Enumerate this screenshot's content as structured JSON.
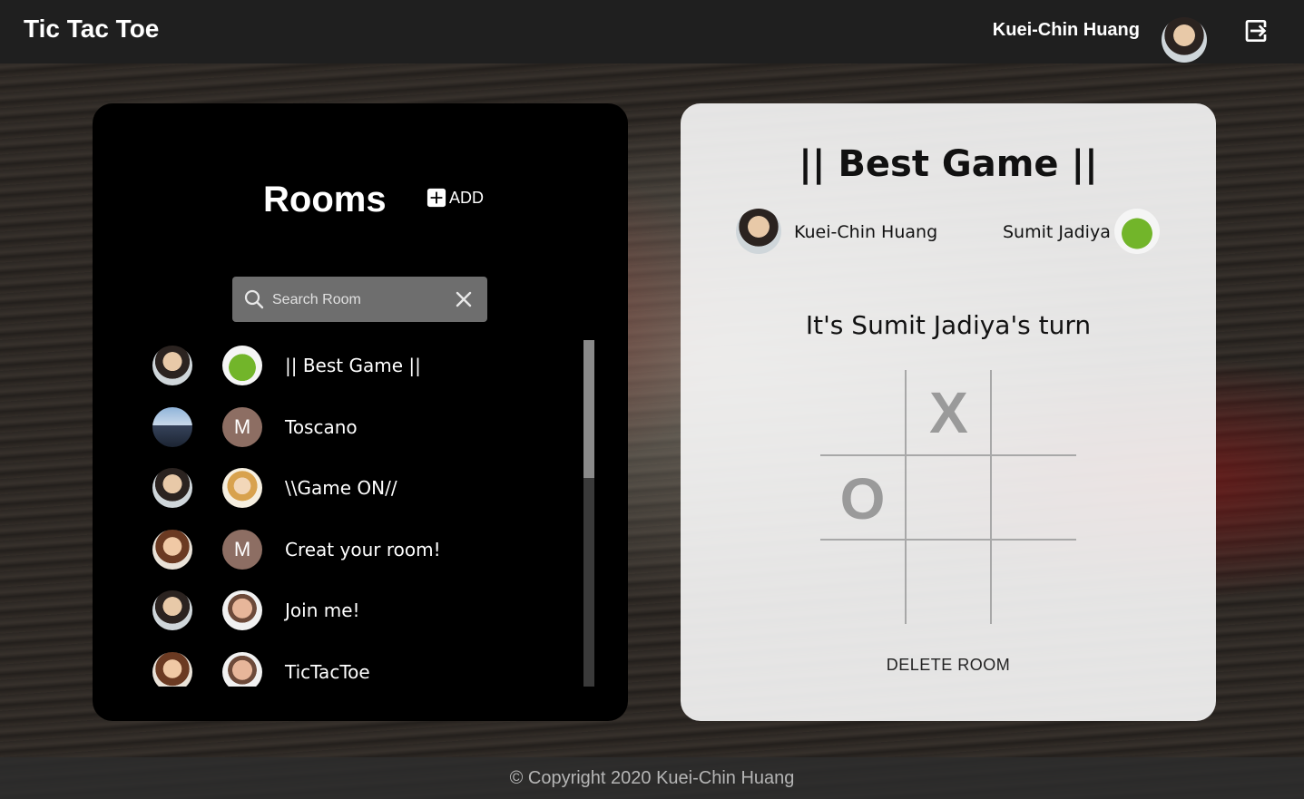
{
  "header": {
    "brand": "Tic Tac Toe",
    "user_name": "Kuei-Chin Huang",
    "avatar_icon": "user-avatar",
    "logout_icon": "logout-icon"
  },
  "rooms": {
    "title": "Rooms",
    "add_label": "ADD",
    "search_placeholder": "Search Room",
    "items": [
      {
        "name": "|| Best Game ||",
        "host_avatar": "woman",
        "guest_avatar": "frog",
        "guest_letter": ""
      },
      {
        "name": "Toscano",
        "host_avatar": "landscape",
        "guest_avatar": "letter",
        "guest_letter": "M"
      },
      {
        "name": "\\\\Game ON//",
        "host_avatar": "woman",
        "guest_avatar": "girl",
        "guest_letter": ""
      },
      {
        "name": "Creat your room!",
        "host_avatar": "woman2",
        "guest_avatar": "letter",
        "guest_letter": "M"
      },
      {
        "name": "Join me!",
        "host_avatar": "woman",
        "guest_avatar": "man",
        "guest_letter": ""
      },
      {
        "name": "TicTacToe",
        "host_avatar": "woman2",
        "guest_avatar": "man",
        "guest_letter": ""
      }
    ]
  },
  "game": {
    "title": "|| Best Game ||",
    "player1": "Kuei-Chin Huang",
    "player2": "Sumit Jadiya",
    "turn_text": "It's Sumit Jadiya's turn",
    "board": [
      "",
      "X",
      "",
      "O",
      "",
      "",
      "",
      "",
      ""
    ],
    "delete_label": "DELETE ROOM"
  },
  "footer": {
    "copyright": "© Copyright 2020 Kuei-Chin Huang"
  },
  "colors": {
    "header_bg": "#1f1f1f",
    "rooms_bg": "#000000",
    "game_bg": "#fafafa",
    "search_bg": "#6e6e6e",
    "letter_avatar": "#8d6e63",
    "mark_color": "#9a9a9a"
  }
}
